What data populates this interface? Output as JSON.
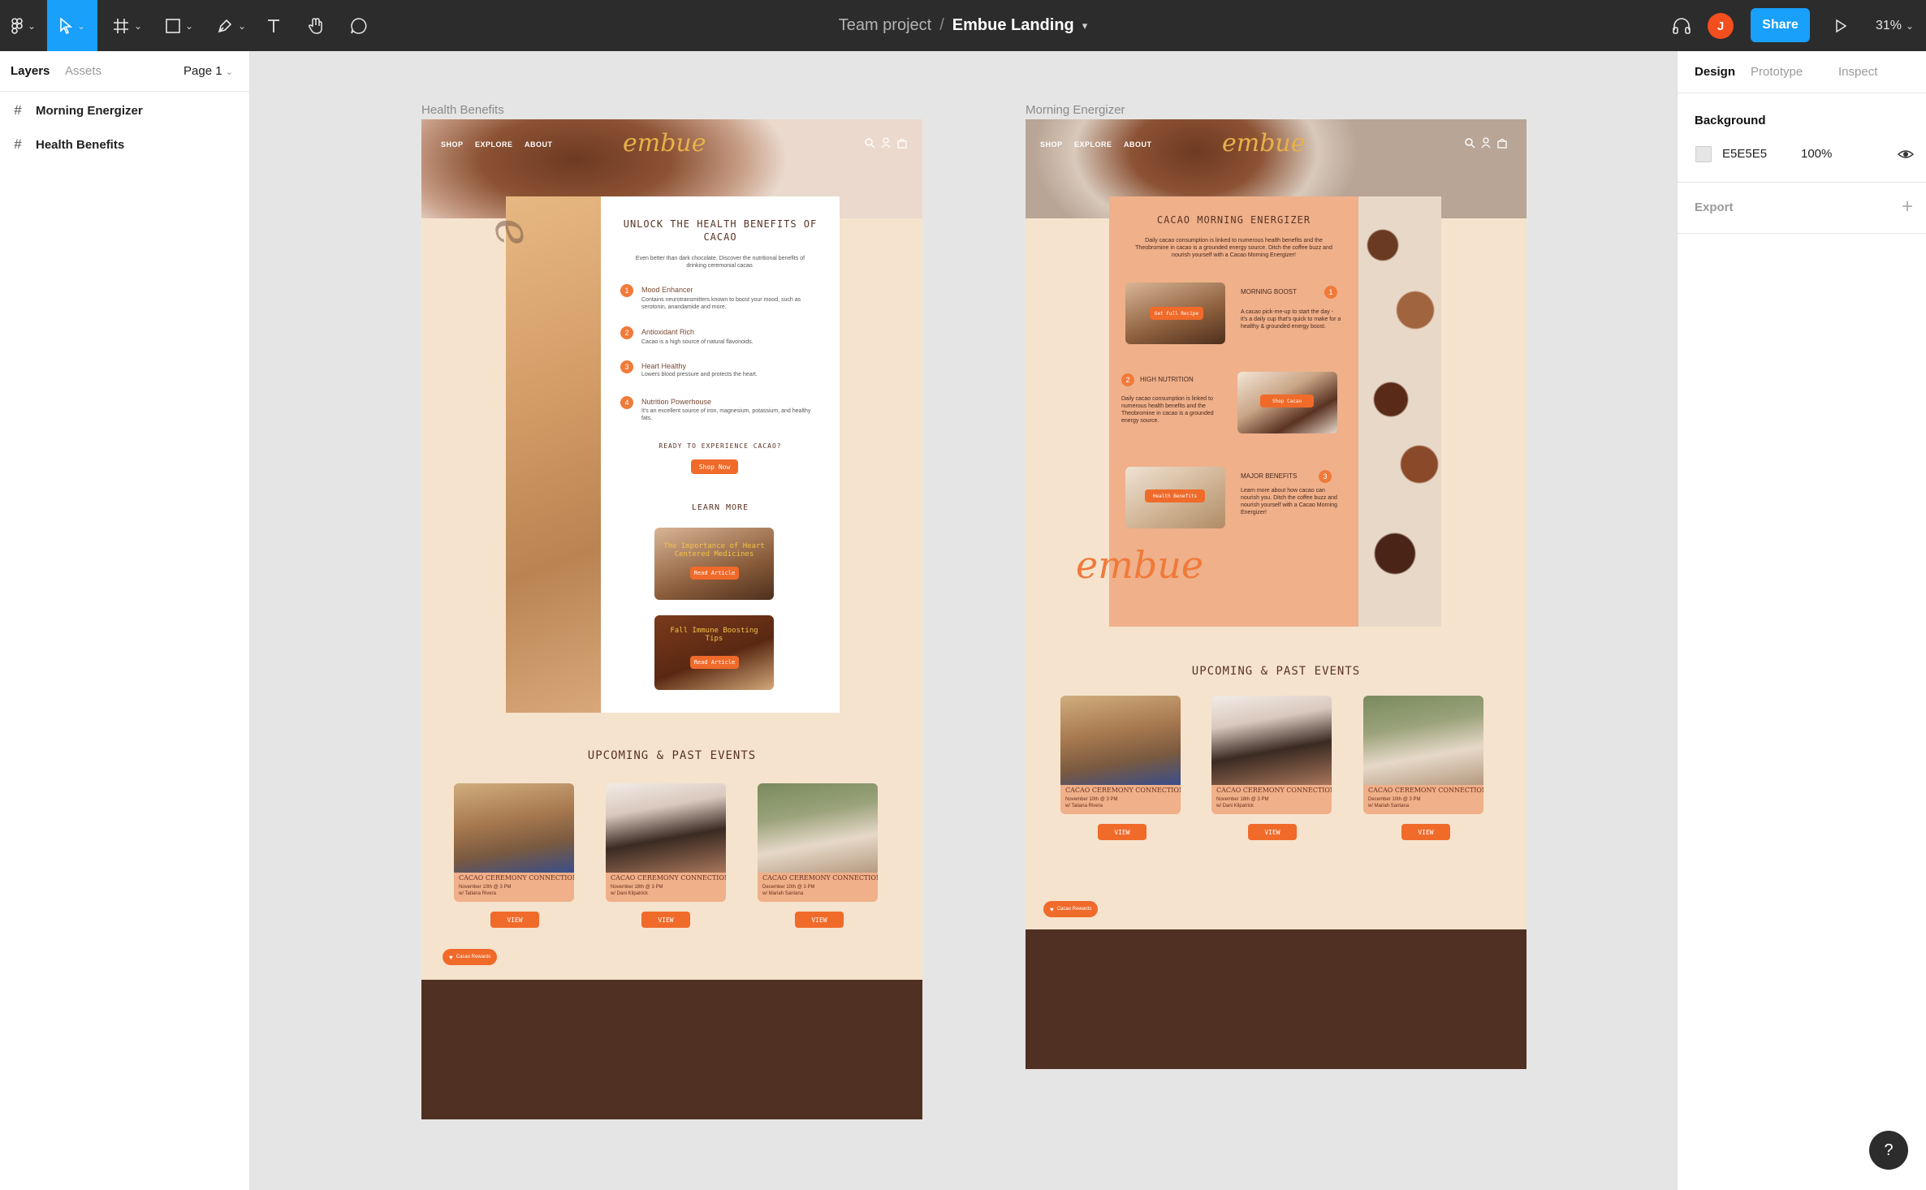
{
  "toolbar": {
    "doc_project": "Team project",
    "doc_separator": "/",
    "doc_file": "Embue Landing",
    "avatar_initial": "J",
    "share_label": "Share",
    "zoom_label": "31%"
  },
  "left_panel": {
    "tabs": [
      "Layers",
      "Assets"
    ],
    "page_selector": "Page 1",
    "layers": [
      "Morning Energizer",
      "Health Benefits"
    ]
  },
  "right_panel": {
    "tabs": [
      "Design",
      "Prototype",
      "Inspect"
    ],
    "background_title": "Background",
    "background_hex": "E5E5E5",
    "background_opacity": "100%",
    "export_label": "Export"
  },
  "frames": {
    "health": {
      "label": "Health Benefits",
      "nav": [
        "SHOP",
        "EXPLORE",
        "ABOUT"
      ],
      "logo": "embue",
      "title": "UNLOCK THE HEALTH BENEFITS OF CACAO",
      "intro": "Even better than dark chocolate. Discover the nutritional benefits of drinking ceremonial cacao.",
      "benefits": [
        {
          "n": "1",
          "title": "Mood Enhancer",
          "text": "Contains neurotransmitters known to boost your mood, such as serotonin, anandamide and more."
        },
        {
          "n": "2",
          "title": "Antioxidant Rich",
          "text": "Cacao is a high source of natural flavonoids."
        },
        {
          "n": "3",
          "title": "Heart Healthy",
          "text": "Lowers blood pressure and protects the heart."
        },
        {
          "n": "4",
          "title": "Nutrition Powerhouse",
          "text": "It's an excellent source of iron, magnesium, potassium, and healthy fats."
        }
      ],
      "cta_question": "READY TO EXPERIENCE CACAO?",
      "shop_now": "Shop Now",
      "learn_more": "LEARN MORE",
      "articles": [
        {
          "title": "The Importance of Heart Centered Medicines",
          "button": "Read Article"
        },
        {
          "title": "Fall Immune Boosting Tips",
          "button": "Read Article"
        }
      ],
      "events_title": "UPCOMING & PAST EVENTS",
      "events": [
        {
          "name": "CACAO CEREMONY CONNECTION",
          "date": "November 10th @ 3 PM",
          "host": "w/ Tatiana Rivera",
          "view": "VIEW"
        },
        {
          "name": "CACAO CEREMONY CONNECTION",
          "date": "November 18th @ 3 PM",
          "host": "w/ Dani Kilpatrick",
          "view": "VIEW"
        },
        {
          "name": "CACAO CEREMONY CONNECTION",
          "date": "December 10th @ 3 PM",
          "host": "w/ Mariah Santana",
          "view": "VIEW"
        }
      ],
      "pill": "Cacao Rewards"
    },
    "morning": {
      "label": "Morning Energizer",
      "nav": [
        "SHOP",
        "EXPLORE",
        "ABOUT"
      ],
      "logo": "embue",
      "title": "CACAO MORNING ENERGIZER",
      "intro": "Daily cacao consumption is linked to numerous health benefits and the Theobromine in cacao is a grounded energy source. Ditch the coffee buzz and nourish yourself with a Cacao Morning Energizer!",
      "sections": [
        {
          "n": "1",
          "title": "MORNING BOOST",
          "text": "A cacao pick-me-up to start the day - it's a daily cup that's quick to make for a healthy & grounded energy boost.",
          "button": "Get Full Recipe"
        },
        {
          "n": "2",
          "title": "HIGH NUTRITION",
          "text": "Daily cacao consumption is linked to numerous health benefits and the Theobromine in cacao is a grounded energy source.",
          "button": "Shop Cacao"
        },
        {
          "n": "3",
          "title": "MAJOR BENEFITS",
          "text": "Learn more about how cacao can nourish you. Ditch the coffee buzz and nourish yourself with a Cacao Morning Energizer!",
          "button": "Health Benefits"
        }
      ],
      "events_title": "UPCOMING & PAST EVENTS",
      "events": [
        {
          "name": "CACAO CEREMONY CONNECTION",
          "date": "November 10th @ 3 PM",
          "host": "w/ Tatiana Rivera",
          "view": "VIEW"
        },
        {
          "name": "CACAO CEREMONY CONNECTION",
          "date": "November 18th @ 3 PM",
          "host": "w/ Dani Kilpatrick",
          "view": "VIEW"
        },
        {
          "name": "CACAO CEREMONY CONNECTION",
          "date": "December 10th @ 3 PM",
          "host": "w/ Mariah Santana",
          "view": "VIEW"
        }
      ],
      "pill": "Cacao Rewards"
    }
  },
  "colors": {
    "toolbar_bg": "#2c2c2c",
    "accent_blue": "#18a0fb",
    "canvas_bg": "#e5e5e5",
    "frame_cream": "#f5e3cd",
    "footer_brown": "#4f3022",
    "cta_orange": "#f06a2a"
  }
}
